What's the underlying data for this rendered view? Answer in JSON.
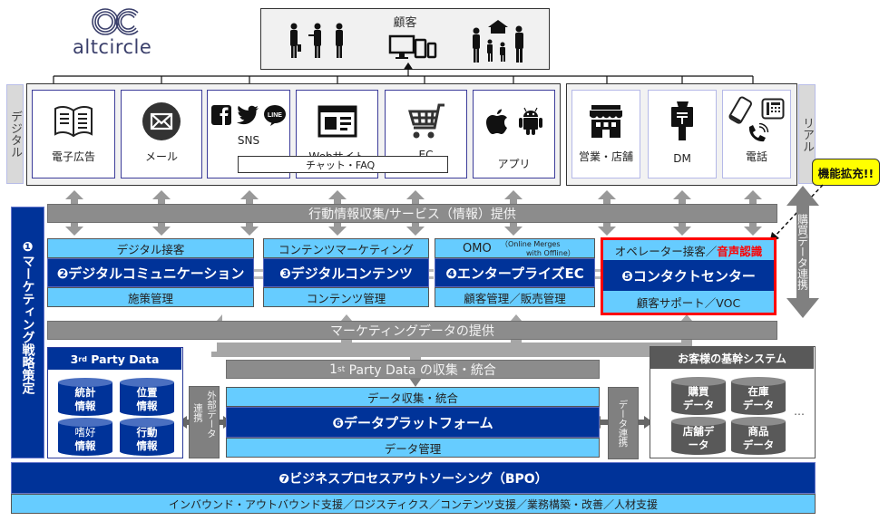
{
  "logo": {
    "text": "altcircle"
  },
  "customer": {
    "title": "顧客"
  },
  "sides": {
    "digital": "デジタル",
    "real": "リアル"
  },
  "channels": {
    "digital": [
      {
        "label": "電子広告",
        "icon": "book-icon"
      },
      {
        "label": "メール",
        "icon": "mail-icon"
      },
      {
        "label": "SNS",
        "icon": "facebook-twitter-line-icon"
      },
      {
        "label": "Webサイト",
        "icon": "webpage-icon"
      },
      {
        "label": "EC",
        "icon": "cart-icon"
      },
      {
        "label": "アプリ",
        "icon": "apple-android-icon"
      }
    ],
    "real": [
      {
        "label": "営業・店舗",
        "icon": "store-icon"
      },
      {
        "label": "DM",
        "icon": "mailbox-icon"
      },
      {
        "label": "電話",
        "icon": "phone-icon"
      }
    ],
    "chat": "チャット・FAQ"
  },
  "bars": {
    "behavior": "行動情報収集/サービス（情報）提供",
    "marketing_data": "マーケティングデータの提供",
    "first_party": {
      "prefix": "1",
      "sup": "st",
      "text": " Party Data の収集・統合"
    }
  },
  "strategy": {
    "num": "❶",
    "label": "マーケティング戦略策定"
  },
  "services": [
    {
      "top": "デジタル接客",
      "title": "❷デジタルコミュニケーション",
      "bottom": "施策管理"
    },
    {
      "top": "コンテンツマーケティング",
      "title": "❸デジタルコンテンツ",
      "bottom": "コンテンツ管理"
    },
    {
      "top": "OMO",
      "top_note_1": "（Online Merges",
      "top_note_2": "with Offline）",
      "title": "❹エンタープライズEC",
      "bottom": "顧客管理／販売管理"
    },
    {
      "top": "オペレーター接客／",
      "top_highlight": "音声認識",
      "title": "❺コンタクトセンター",
      "bottom": "顧客サポート／VOC"
    }
  ],
  "callout": {
    "label": "機能拡充!!"
  },
  "purchase_link": "購買データ連携",
  "third_party": {
    "title_num": "3",
    "title_sup": "rd",
    "title_rest": " Party Data",
    "items": [
      {
        "l1": "統計",
        "l2": "情報"
      },
      {
        "l1": "位置",
        "l2": "情報"
      },
      {
        "l1": "嗜好",
        "l2": "情報"
      },
      {
        "l1": "行動",
        "l2": "情報"
      }
    ]
  },
  "external_link": {
    "a": "外部データ",
    "b": "連携"
  },
  "data_link": "データ連携",
  "platform": {
    "top": "データ収集・統合",
    "title": "❻データプラットフォーム",
    "bottom": "データ管理"
  },
  "core_system": {
    "title": "お客様の基幹システム",
    "items": [
      {
        "l1": "購買",
        "l2": "データ"
      },
      {
        "l1": "在庫",
        "l2": "データ"
      },
      {
        "l1": "店舗デ",
        "l2": "ータ"
      },
      {
        "l1": "商品",
        "l2": "データ"
      }
    ],
    "more": "…"
  },
  "bpo": {
    "title": "❼ビジネスプロセスアウトソーシング（BPO）",
    "sub": "インバウンド・アウトバウンド支援／ロジスティクス／コンテンツ支援／業務構築・改善／人材支援"
  },
  "colors": {
    "navy": "#003399",
    "sky": "#66ccff",
    "gray": "#8c8c8c",
    "red": "#ff0000",
    "yellow": "#ffff00"
  }
}
